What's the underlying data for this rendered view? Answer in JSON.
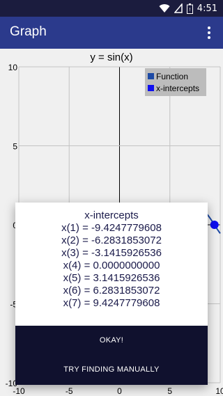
{
  "status_bar": {
    "time": "4:51",
    "icons": [
      "wifi-icon",
      "signal-icon",
      "battery-icon"
    ]
  },
  "app_bar": {
    "title": "Graph",
    "overflow_icon": "more-vert-icon"
  },
  "graph": {
    "title": "y = sin(x)",
    "legend": [
      {
        "label": "Function",
        "color": "#1f4fb0"
      },
      {
        "label": "x-intercepts",
        "color": "#1010ff"
      }
    ]
  },
  "chart_data": {
    "type": "line",
    "title": "y = sin(x)",
    "xlim": [
      -10,
      10
    ],
    "ylim": [
      -10,
      10
    ],
    "xticks": [
      "-10",
      "-5",
      "0",
      "5",
      "10"
    ],
    "yticks": [
      "10",
      "5",
      "0",
      "-5",
      "-10"
    ],
    "grid": true,
    "legend_position": "top-right",
    "series": [
      {
        "name": "Function",
        "color": "#1f4fb0",
        "function": "sin(x)"
      },
      {
        "name": "x-intercepts",
        "color": "#1010ff",
        "x": [
          -9.4247779608,
          -6.2831853072,
          -3.1415926536,
          0.0,
          3.1415926536,
          6.2831853072,
          9.4247779608
        ],
        "y": [
          0,
          0,
          0,
          0,
          0,
          0,
          0
        ]
      }
    ]
  },
  "dialog": {
    "title": "x-intercepts",
    "lines": [
      "x(1) = -9.4247779608",
      "x(2) = -6.2831853072",
      "x(3) = -3.1415926536",
      "x(4) = 0.0000000000",
      "x(5) = 3.1415926536",
      "x(6) = 6.2831853072",
      "x(7) = 9.4247779608"
    ],
    "ok_label": "OKAY!",
    "manual_label": "TRY FINDING MANUALLY"
  }
}
